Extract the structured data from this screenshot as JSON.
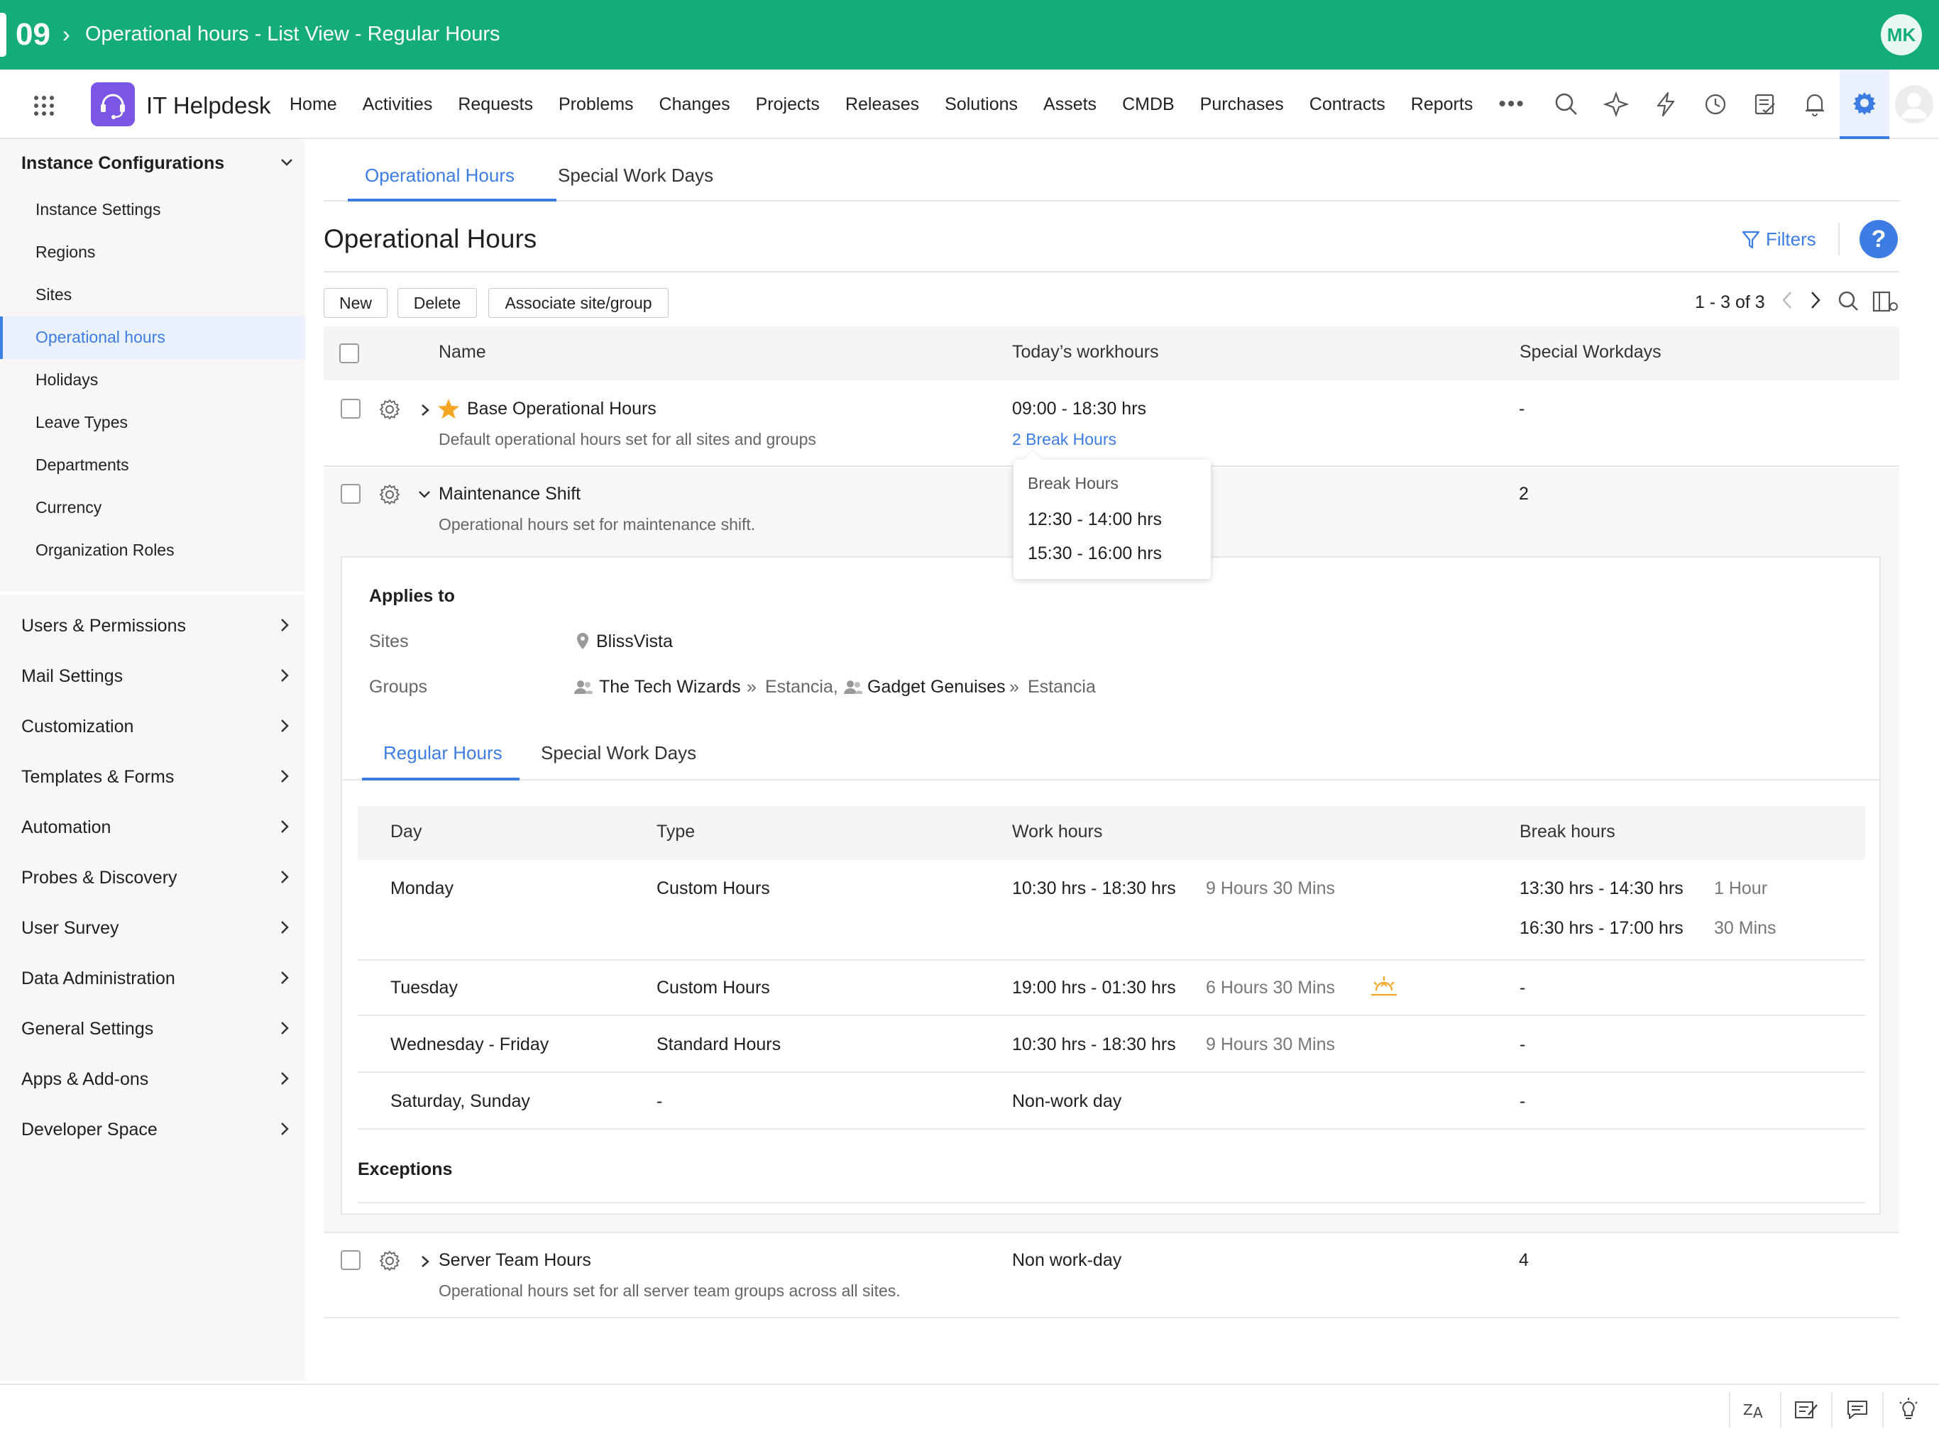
{
  "topbar": {
    "step": "09",
    "title": "Operational hours - List View - Regular Hours",
    "avatar_initials": "MK"
  },
  "app": {
    "name": "IT Helpdesk"
  },
  "nav": {
    "items": [
      "Home",
      "Activities",
      "Requests",
      "Problems",
      "Changes",
      "Projects",
      "Releases",
      "Solutions",
      "Assets",
      "CMDB",
      "Purchases",
      "Contracts",
      "Reports"
    ],
    "more": "•••",
    "icons": [
      "search-icon",
      "sparkle-icon",
      "lightning-icon",
      "history-icon",
      "tasks-icon",
      "bell-icon",
      "settings-icon",
      "profile-icon"
    ]
  },
  "sidebar": {
    "section_title": "Instance Configurations",
    "sub_items": [
      "Instance Settings",
      "Regions",
      "Sites",
      "Operational hours",
      "Holidays",
      "Leave Types",
      "Departments",
      "Currency",
      "Organization Roles"
    ],
    "active_sub_item": "Operational hours",
    "groups": [
      "Users & Permissions",
      "Mail Settings",
      "Customization",
      "Templates & Forms",
      "Automation",
      "Probes & Discovery",
      "User Survey",
      "Data Administration",
      "General Settings",
      "Apps & Add-ons",
      "Developer Space"
    ]
  },
  "main": {
    "tabs": [
      "Operational Hours",
      "Special Work Days"
    ],
    "title": "Operational Hours",
    "filters_label": "Filters",
    "help_label": "?",
    "buttons": {
      "new": "New",
      "delete": "Delete",
      "associate": "Associate site/group"
    },
    "pager": "1 - 3 of 3",
    "columns": [
      "Name",
      "Today’s workhours",
      "Special Workdays"
    ],
    "rows": [
      {
        "name": "Base Operational Hours",
        "desc": "Default operational hours set for all sites and groups",
        "workhours": "09:00 - 18:30 hrs",
        "break_link": "2 Break Hours",
        "special": "-"
      },
      {
        "name": "Maintenance Shift",
        "desc": "Operational hours set for maintenance shift.",
        "workhours": "",
        "special": "2"
      },
      {
        "name": "Server Team Hours",
        "desc": "Operational hours set for all server team groups across all sites.",
        "workhours": "Non work-day",
        "special": "4"
      }
    ],
    "popover": {
      "title": "Break Hours",
      "values": [
        "12:30 - 14:00 hrs",
        "15:30 - 16:00 hrs"
      ]
    },
    "details": {
      "applies_to": "Applies to",
      "sites_label": "Sites",
      "site_value": "BlissVista",
      "groups_label": "Groups",
      "group1": "The Tech Wizards",
      "group1_site": "Estancia,",
      "group2": "Gadget Genuises",
      "group2_site": "Estancia",
      "tabs": [
        "Regular Hours",
        "Special Work Days"
      ],
      "table_columns": [
        "Day",
        "Type",
        "Work hours",
        "Break hours"
      ],
      "table_rows": [
        {
          "day": "Monday",
          "type": "Custom Hours",
          "work": "10:30 hrs - 18:30 hrs",
          "duration": "9 Hours 30 Mins",
          "breaks": [
            {
              "time": "13:30 hrs - 14:30 hrs",
              "dur": "1 Hour"
            },
            {
              "time": "16:30 hrs - 17:00 hrs",
              "dur": "30 Mins"
            }
          ]
        },
        {
          "day": "Tuesday",
          "type": "Custom Hours",
          "work": "19:00 hrs - 01:30 hrs",
          "duration": "6 Hours 30 Mins",
          "break": "-"
        },
        {
          "day": "Wednesday - Friday",
          "type": "Standard Hours",
          "work": "10:30 hrs - 18:30 hrs",
          "duration": "9 Hours 30 Mins",
          "break": "-"
        },
        {
          "day": "Saturday, Sunday",
          "type": "-",
          "work": "Non-work day",
          "duration": "",
          "break": "-"
        }
      ],
      "exceptions": "Exceptions"
    }
  },
  "bottombar": {
    "icons": [
      "translate-icon",
      "notes-icon",
      "chat-icon",
      "bulb-icon"
    ]
  },
  "colors": {
    "brand_green": "#14ad78",
    "accent_blue": "#3d7de3",
    "star": "#f5a623",
    "sunrise": "#f5a623"
  }
}
